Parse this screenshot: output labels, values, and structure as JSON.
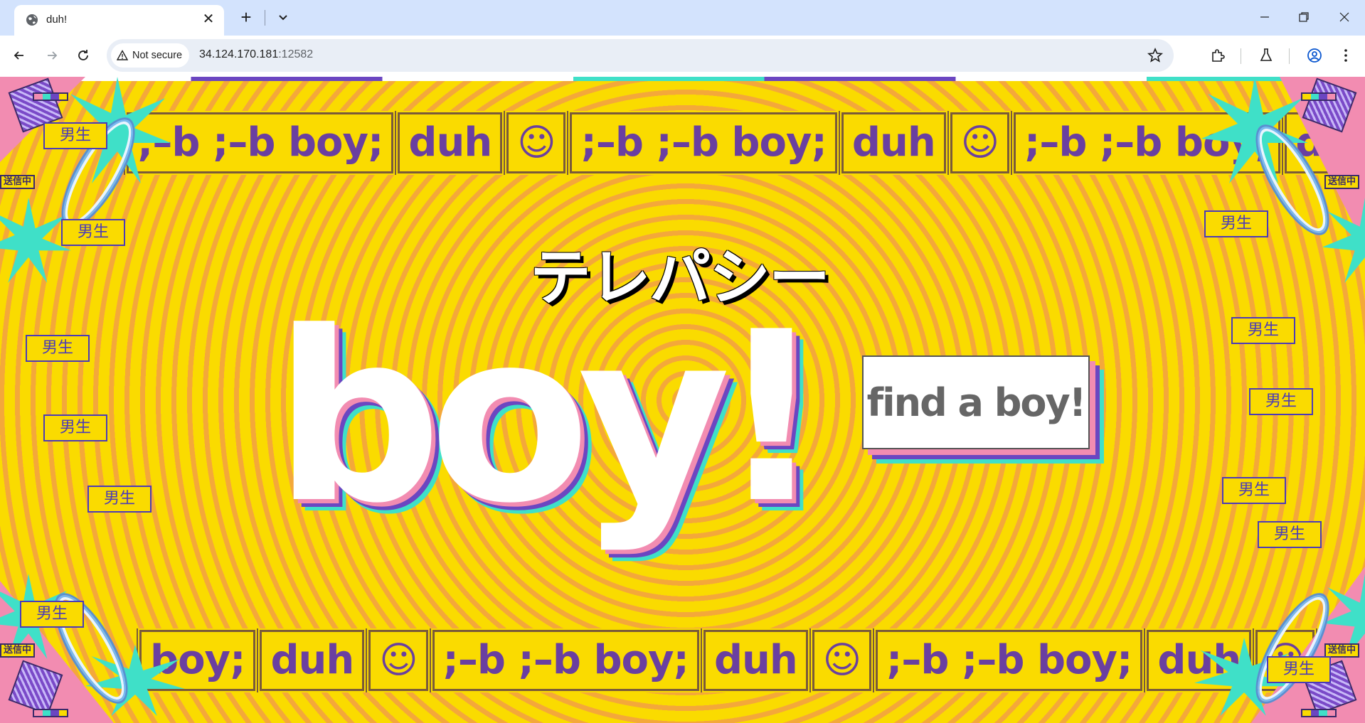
{
  "browser": {
    "tab_title": "duh!",
    "security_label": "Not secure",
    "url_host": "34.124.170.181",
    "url_port": ":12582"
  },
  "page": {
    "katakana_heading": "テレパシー",
    "main_heading": "boy!",
    "find_button_label": "find a boy!",
    "kanji_label": "男生",
    "marquee_top": [
      ";–b ;–b boy;",
      "duh",
      "☺",
      ";–b ;–b boy;",
      "duh",
      "☺",
      ";–b ;–b boy;",
      "duh"
    ],
    "marquee_bottom": [
      "boy;",
      "duh",
      "☺",
      ";–b ;–b boy;",
      "duh",
      "☺",
      ";–b ;–b boy;",
      "duh",
      "☺"
    ],
    "sending_tag": "送信中"
  },
  "colors": {
    "background_yellow": "#fadb00",
    "ring_orange": "#f4a83a",
    "text_purple": "#6a3fa0",
    "accent_pink": "#f28cb1",
    "accent_purple": "#6b46c1",
    "accent_teal": "#3fe0c8"
  }
}
